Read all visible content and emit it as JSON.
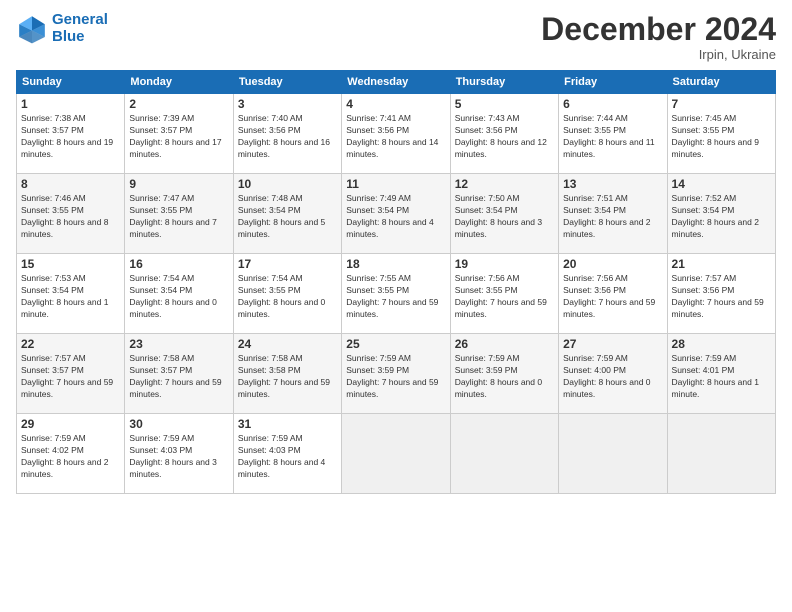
{
  "header": {
    "logo_line1": "General",
    "logo_line2": "Blue",
    "month_title": "December 2024",
    "location": "Irpin, Ukraine"
  },
  "weekdays": [
    "Sunday",
    "Monday",
    "Tuesday",
    "Wednesday",
    "Thursday",
    "Friday",
    "Saturday"
  ],
  "weeks": [
    [
      {
        "day": "1",
        "sunrise": "Sunrise: 7:38 AM",
        "sunset": "Sunset: 3:57 PM",
        "daylight": "Daylight: 8 hours and 19 minutes."
      },
      {
        "day": "2",
        "sunrise": "Sunrise: 7:39 AM",
        "sunset": "Sunset: 3:57 PM",
        "daylight": "Daylight: 8 hours and 17 minutes."
      },
      {
        "day": "3",
        "sunrise": "Sunrise: 7:40 AM",
        "sunset": "Sunset: 3:56 PM",
        "daylight": "Daylight: 8 hours and 16 minutes."
      },
      {
        "day": "4",
        "sunrise": "Sunrise: 7:41 AM",
        "sunset": "Sunset: 3:56 PM",
        "daylight": "Daylight: 8 hours and 14 minutes."
      },
      {
        "day": "5",
        "sunrise": "Sunrise: 7:43 AM",
        "sunset": "Sunset: 3:56 PM",
        "daylight": "Daylight: 8 hours and 12 minutes."
      },
      {
        "day": "6",
        "sunrise": "Sunrise: 7:44 AM",
        "sunset": "Sunset: 3:55 PM",
        "daylight": "Daylight: 8 hours and 11 minutes."
      },
      {
        "day": "7",
        "sunrise": "Sunrise: 7:45 AM",
        "sunset": "Sunset: 3:55 PM",
        "daylight": "Daylight: 8 hours and 9 minutes."
      }
    ],
    [
      {
        "day": "8",
        "sunrise": "Sunrise: 7:46 AM",
        "sunset": "Sunset: 3:55 PM",
        "daylight": "Daylight: 8 hours and 8 minutes."
      },
      {
        "day": "9",
        "sunrise": "Sunrise: 7:47 AM",
        "sunset": "Sunset: 3:55 PM",
        "daylight": "Daylight: 8 hours and 7 minutes."
      },
      {
        "day": "10",
        "sunrise": "Sunrise: 7:48 AM",
        "sunset": "Sunset: 3:54 PM",
        "daylight": "Daylight: 8 hours and 5 minutes."
      },
      {
        "day": "11",
        "sunrise": "Sunrise: 7:49 AM",
        "sunset": "Sunset: 3:54 PM",
        "daylight": "Daylight: 8 hours and 4 minutes."
      },
      {
        "day": "12",
        "sunrise": "Sunrise: 7:50 AM",
        "sunset": "Sunset: 3:54 PM",
        "daylight": "Daylight: 8 hours and 3 minutes."
      },
      {
        "day": "13",
        "sunrise": "Sunrise: 7:51 AM",
        "sunset": "Sunset: 3:54 PM",
        "daylight": "Daylight: 8 hours and 2 minutes."
      },
      {
        "day": "14",
        "sunrise": "Sunrise: 7:52 AM",
        "sunset": "Sunset: 3:54 PM",
        "daylight": "Daylight: 8 hours and 2 minutes."
      }
    ],
    [
      {
        "day": "15",
        "sunrise": "Sunrise: 7:53 AM",
        "sunset": "Sunset: 3:54 PM",
        "daylight": "Daylight: 8 hours and 1 minute."
      },
      {
        "day": "16",
        "sunrise": "Sunrise: 7:54 AM",
        "sunset": "Sunset: 3:54 PM",
        "daylight": "Daylight: 8 hours and 0 minutes."
      },
      {
        "day": "17",
        "sunrise": "Sunrise: 7:54 AM",
        "sunset": "Sunset: 3:55 PM",
        "daylight": "Daylight: 8 hours and 0 minutes."
      },
      {
        "day": "18",
        "sunrise": "Sunrise: 7:55 AM",
        "sunset": "Sunset: 3:55 PM",
        "daylight": "Daylight: 7 hours and 59 minutes."
      },
      {
        "day": "19",
        "sunrise": "Sunrise: 7:56 AM",
        "sunset": "Sunset: 3:55 PM",
        "daylight": "Daylight: 7 hours and 59 minutes."
      },
      {
        "day": "20",
        "sunrise": "Sunrise: 7:56 AM",
        "sunset": "Sunset: 3:56 PM",
        "daylight": "Daylight: 7 hours and 59 minutes."
      },
      {
        "day": "21",
        "sunrise": "Sunrise: 7:57 AM",
        "sunset": "Sunset: 3:56 PM",
        "daylight": "Daylight: 7 hours and 59 minutes."
      }
    ],
    [
      {
        "day": "22",
        "sunrise": "Sunrise: 7:57 AM",
        "sunset": "Sunset: 3:57 PM",
        "daylight": "Daylight: 7 hours and 59 minutes."
      },
      {
        "day": "23",
        "sunrise": "Sunrise: 7:58 AM",
        "sunset": "Sunset: 3:57 PM",
        "daylight": "Daylight: 7 hours and 59 minutes."
      },
      {
        "day": "24",
        "sunrise": "Sunrise: 7:58 AM",
        "sunset": "Sunset: 3:58 PM",
        "daylight": "Daylight: 7 hours and 59 minutes."
      },
      {
        "day": "25",
        "sunrise": "Sunrise: 7:59 AM",
        "sunset": "Sunset: 3:59 PM",
        "daylight": "Daylight: 7 hours and 59 minutes."
      },
      {
        "day": "26",
        "sunrise": "Sunrise: 7:59 AM",
        "sunset": "Sunset: 3:59 PM",
        "daylight": "Daylight: 8 hours and 0 minutes."
      },
      {
        "day": "27",
        "sunrise": "Sunrise: 7:59 AM",
        "sunset": "Sunset: 4:00 PM",
        "daylight": "Daylight: 8 hours and 0 minutes."
      },
      {
        "day": "28",
        "sunrise": "Sunrise: 7:59 AM",
        "sunset": "Sunset: 4:01 PM",
        "daylight": "Daylight: 8 hours and 1 minute."
      }
    ],
    [
      {
        "day": "29",
        "sunrise": "Sunrise: 7:59 AM",
        "sunset": "Sunset: 4:02 PM",
        "daylight": "Daylight: 8 hours and 2 minutes."
      },
      {
        "day": "30",
        "sunrise": "Sunrise: 7:59 AM",
        "sunset": "Sunset: 4:03 PM",
        "daylight": "Daylight: 8 hours and 3 minutes."
      },
      {
        "day": "31",
        "sunrise": "Sunrise: 7:59 AM",
        "sunset": "Sunset: 4:03 PM",
        "daylight": "Daylight: 8 hours and 4 minutes."
      },
      null,
      null,
      null,
      null
    ]
  ]
}
